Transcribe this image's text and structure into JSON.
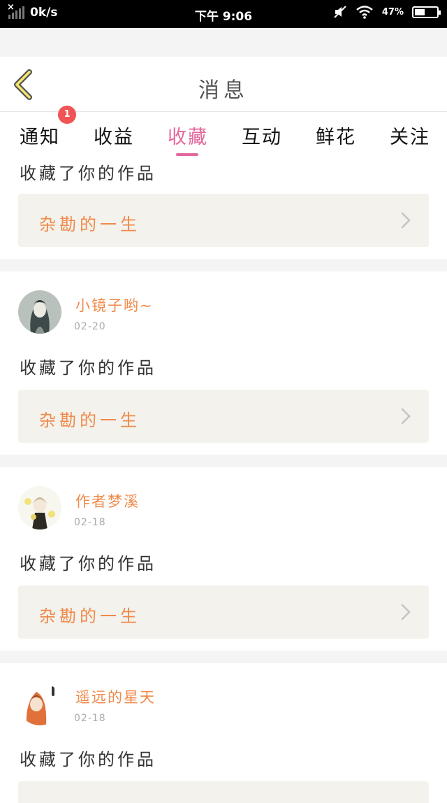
{
  "status_bar": {
    "net_speed": "0k/s",
    "time": "下午 9:06",
    "battery": "47%",
    "battery_level": 0.47,
    "icons": [
      "signal-off-icon",
      "mute-icon",
      "wifi-icon",
      "battery-icon"
    ]
  },
  "header": {
    "title": "消息",
    "back_icon": "chevron-left-icon"
  },
  "tabs": [
    {
      "label": "通知",
      "badge": "1"
    },
    {
      "label": "收益"
    },
    {
      "label": "收藏",
      "active": true
    },
    {
      "label": "互动"
    },
    {
      "label": "鲜花"
    },
    {
      "label": "关注"
    }
  ],
  "feed": {
    "partial_top": {
      "action": "收藏了你的作品",
      "work_title": "杂勘的一生"
    },
    "items": [
      {
        "username": "小镜子哟~",
        "date": "02-20",
        "action": "收藏了你的作品",
        "work_title": "杂勘的一生"
      },
      {
        "username": "作者梦溪",
        "date": "02-18",
        "action": "收藏了你的作品",
        "work_title": "杂勘的一生"
      },
      {
        "username": "遥远的星天",
        "date": "02-18",
        "action": "收藏了你的作品"
      }
    ]
  },
  "colors": {
    "accent_pink": "#e5679b",
    "name_orange": "#f08a4b",
    "badge_red": "#f05454",
    "work_bg": "#f3f2ec"
  }
}
